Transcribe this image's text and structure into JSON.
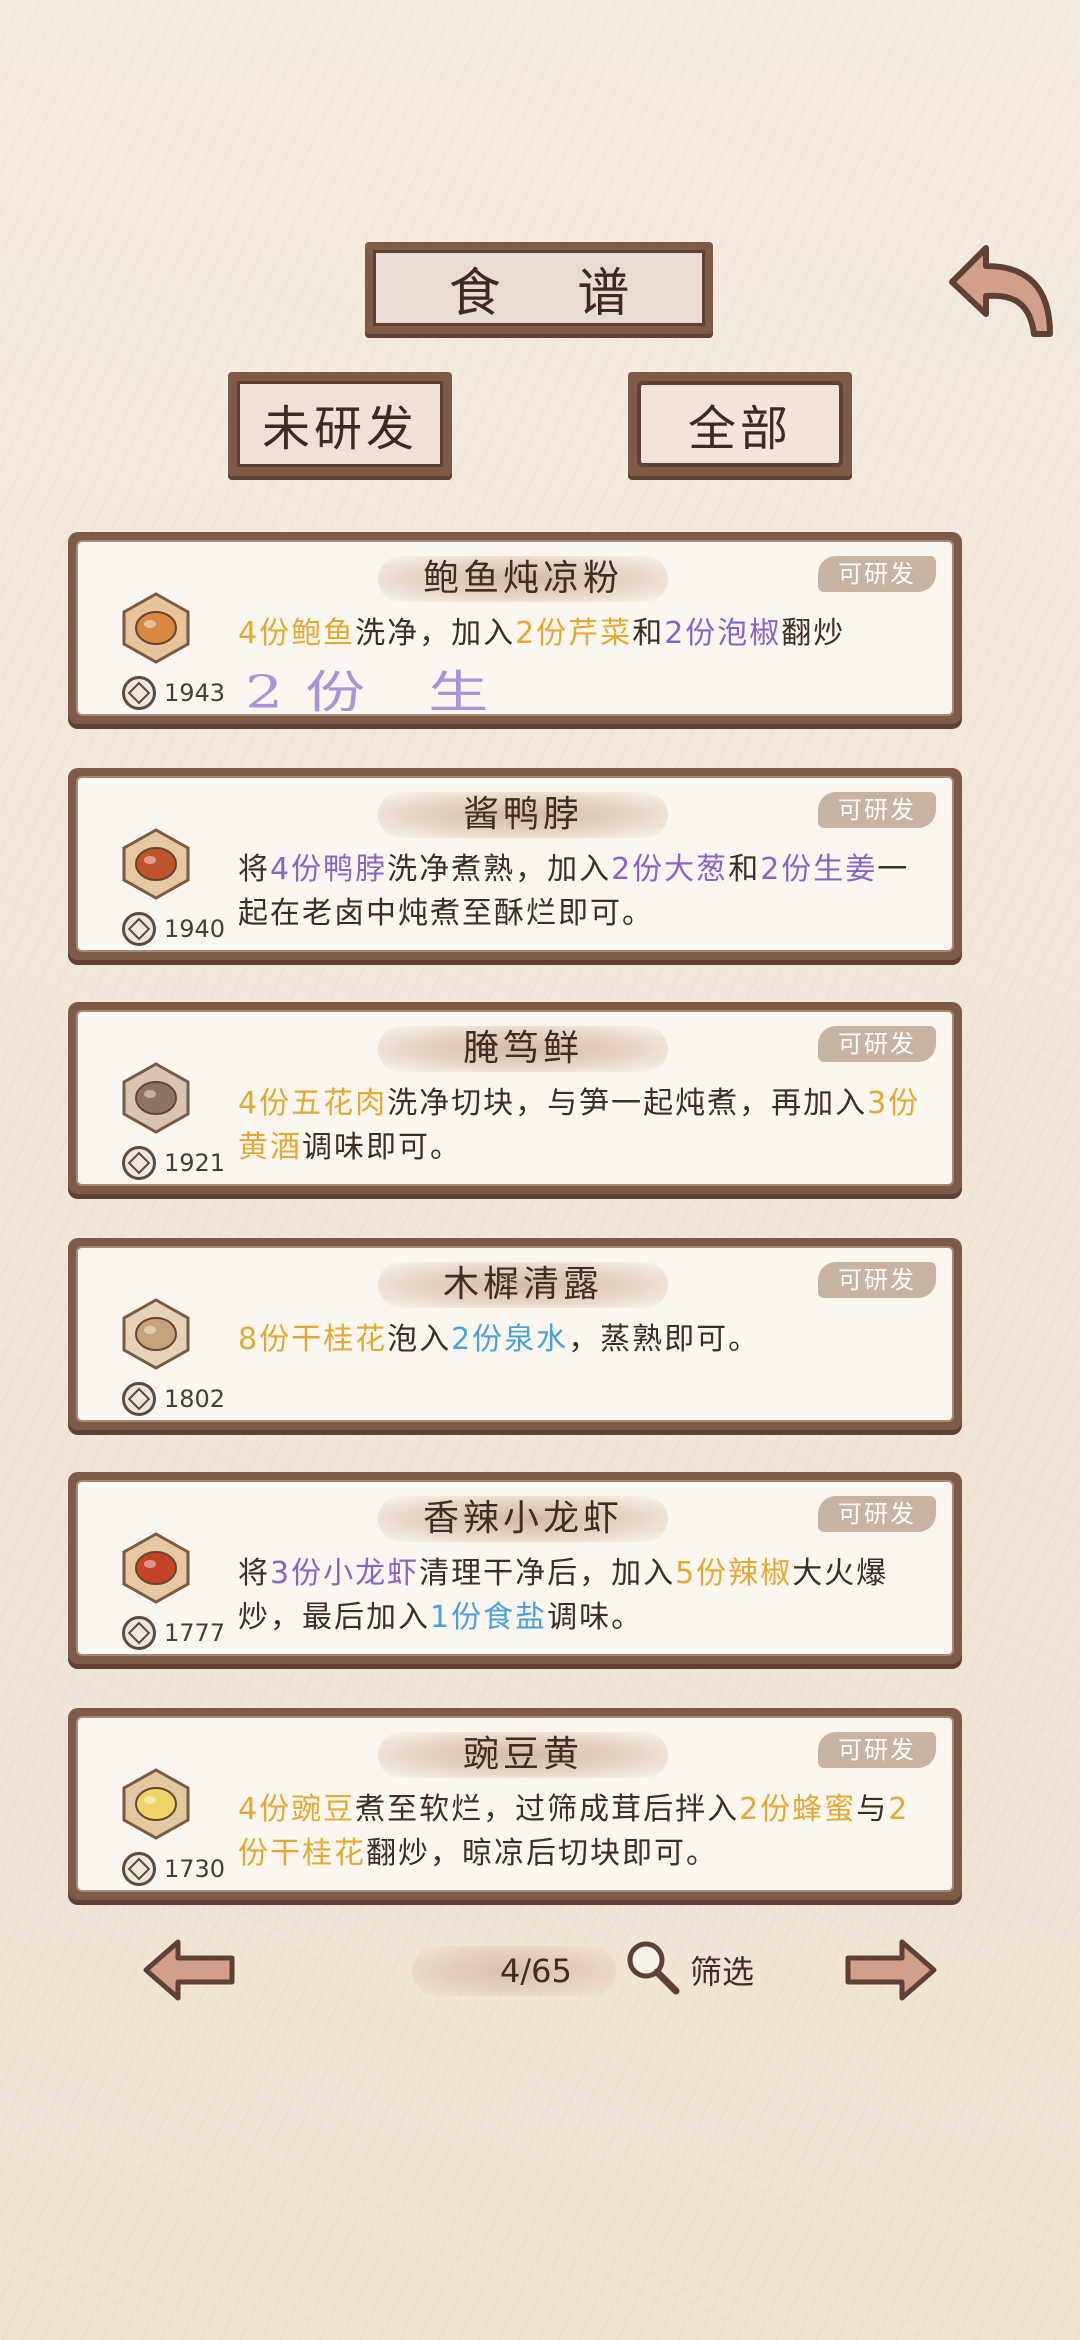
{
  "header": {
    "title": "食 谱"
  },
  "tabs": [
    {
      "label": "未研发"
    },
    {
      "label": "全部"
    }
  ],
  "overlay_text": "2份 生",
  "recipes": [
    {
      "name": "鲍鱼炖凉粉",
      "badge": "可研发",
      "cost": "1943",
      "desc": [
        [
          "y",
          "4份鲍鱼"
        ],
        [
          "n",
          "洗净，加入"
        ],
        [
          "y",
          "2份芹菜"
        ],
        [
          "n",
          "和"
        ],
        [
          "p",
          "2份泡椒"
        ],
        [
          "n",
          "翻炒"
        ]
      ]
    },
    {
      "name": "酱鸭脖",
      "badge": "可研发",
      "cost": "1940",
      "desc": [
        [
          "n",
          "将"
        ],
        [
          "p",
          "4份鸭脖"
        ],
        [
          "n",
          "洗净煮熟，加入"
        ],
        [
          "p",
          "2份大葱"
        ],
        [
          "n",
          "和"
        ],
        [
          "p",
          "2份生姜"
        ],
        [
          "n",
          "一起在老卤中炖煮至酥烂即可。"
        ]
      ]
    },
    {
      "name": "腌笃鲜",
      "badge": "可研发",
      "cost": "1921",
      "desc": [
        [
          "y",
          "4份五花肉"
        ],
        [
          "n",
          "洗净切块，与笋一起炖煮，再加入"
        ],
        [
          "y",
          "3份黄酒"
        ],
        [
          "n",
          "调味即可。"
        ]
      ]
    },
    {
      "name": "木樨清露",
      "badge": "可研发",
      "cost": "1802",
      "desc": [
        [
          "y",
          "8份干桂花"
        ],
        [
          "n",
          "泡入"
        ],
        [
          "b",
          "2份泉水"
        ],
        [
          "n",
          "，蒸熟即可。"
        ]
      ]
    },
    {
      "name": "香辣小龙虾",
      "badge": "可研发",
      "cost": "1777",
      "desc": [
        [
          "n",
          "将"
        ],
        [
          "p",
          "3份小龙虾"
        ],
        [
          "n",
          "清理干净后，加入"
        ],
        [
          "y",
          "5份辣椒"
        ],
        [
          "n",
          "大火爆炒，最后加入"
        ],
        [
          "b",
          "1份食盐"
        ],
        [
          "n",
          "调味。"
        ]
      ]
    },
    {
      "name": "豌豆黄",
      "badge": "可研发",
      "cost": "1730",
      "desc": [
        [
          "y",
          "4份豌豆"
        ],
        [
          "n",
          "煮至软烂，过筛成茸后拌入"
        ],
        [
          "y",
          "2份蜂蜜"
        ],
        [
          "n",
          "与"
        ],
        [
          "y",
          "2份干桂花"
        ],
        [
          "n",
          "翻炒，晾凉后切块即可。"
        ]
      ]
    }
  ],
  "pager": {
    "page": "4/65",
    "filter_label": "筛选"
  },
  "colors": {
    "frame": "#7e5a47",
    "yellow": "#e3a933",
    "purple": "#8a63c9",
    "blue": "#4ba1d9"
  }
}
